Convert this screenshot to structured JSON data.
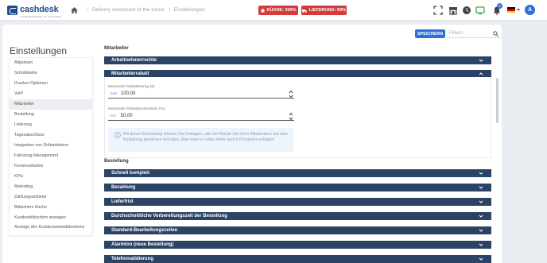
{
  "app": {
    "logo_name": "cashdesk",
    "logo_sub": "YOUR BUSINESS AT A GLANCE"
  },
  "breadcrumb": {
    "restaurant": "Delivery restaurant of the future",
    "page": "Einstellungen"
  },
  "badges": {
    "kueche": "KÜCHE: 300%",
    "lieferung": "LIEFERUNG: 50%"
  },
  "topbar": {
    "notification_count": "0",
    "avatar_initial": "A"
  },
  "header": {
    "title": "Einstellungen",
    "save_label": "SPEICHERN",
    "filter_placeholder": "Filtern"
  },
  "sidebar": {
    "items": [
      {
        "label": "Allgemein"
      },
      {
        "label": "Schnittstelle"
      },
      {
        "label": "Drucker-Optionen"
      },
      {
        "label": "VoIP"
      },
      {
        "label": "Mitarbeiter",
        "active": true
      },
      {
        "label": "Bestellung"
      },
      {
        "label": "Lieferung"
      },
      {
        "label": "Tagesabschluss"
      },
      {
        "label": "Integration von Drittanbietern"
      },
      {
        "label": "Fahrzeug-Management"
      },
      {
        "label": "Kommunikation"
      },
      {
        "label": "KPIs"
      },
      {
        "label": "Marketing"
      },
      {
        "label": "Zahlungsanbieter"
      },
      {
        "label": "Bildschirm Küche"
      },
      {
        "label": "Kundenbildschirm anzeigen"
      },
      {
        "label": "Anzeige des Kundenwartebildschirms"
      }
    ]
  },
  "mitarbeiter": {
    "section_label": "Mitarbeiter",
    "accordions": {
      "rechte": "Arbeitnehmerrechte",
      "rabatt": "Mitarbeiterrabatt"
    },
    "fields": {
      "max_amount_label": "Maximaler Rabattbetrag (€)",
      "max_amount_prefix": "EUR",
      "max_amount_value": "100,00",
      "max_percent_label": "Maximaler Rabattprozentsatz (%)",
      "max_percent_prefix": "PCT",
      "max_percent_value": "50,00"
    },
    "info_text": "Mit dieser Einstellung können Sie festlegen, wie viel Rabatt Sie Ihren Mitarbeitern auf eine Bestellung gewähren möchten. Dies kann in voller Höhe und in Prozenten erfolgen"
  },
  "bestellung": {
    "section_label": "Bestellung",
    "accordions": [
      {
        "label": "Schnell komplett"
      },
      {
        "label": "Bezahlung"
      },
      {
        "label": "Lieferfrist"
      },
      {
        "label": "Durchschnittliche Vorbereitungszeit der Bestellung"
      },
      {
        "label": "Standard-Bearbeitungszeiten"
      },
      {
        "label": "Alarmton (neue Bestellung)"
      },
      {
        "label": "Telefonvalidierung"
      }
    ]
  },
  "colors": {
    "accordion": "#2b4466",
    "accent": "#2f6fdd",
    "badge": "#d63a3a"
  },
  "icons": [
    "home-icon",
    "fullscreen-icon",
    "store-icon",
    "clock-icon",
    "bell-icon",
    "monitor-icon",
    "flag-de-icon",
    "search-icon",
    "chevron-down-icon",
    "chevron-up-icon",
    "info-icon"
  ]
}
